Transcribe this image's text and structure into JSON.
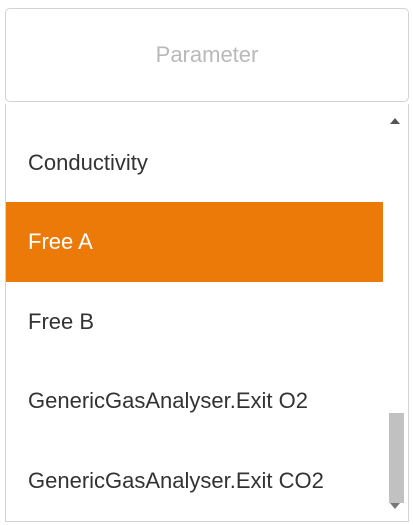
{
  "parameter_input": {
    "placeholder": "Parameter",
    "value": ""
  },
  "dropdown": {
    "items": [
      {
        "label": "Conductivity",
        "selected": false
      },
      {
        "label": "Free A",
        "selected": true
      },
      {
        "label": "Free B",
        "selected": false
      },
      {
        "label": "GenericGasAnalyser.Exit O2",
        "selected": false
      },
      {
        "label": "GenericGasAnalyser.Exit CO2",
        "selected": false
      }
    ],
    "scroll_position_percent": 100
  },
  "colors": {
    "selected_background": "#ec7a08",
    "selected_text": "#ffffff",
    "item_text": "#333333",
    "placeholder_text": "#b9b9b9",
    "border": "#d3d3d3"
  }
}
